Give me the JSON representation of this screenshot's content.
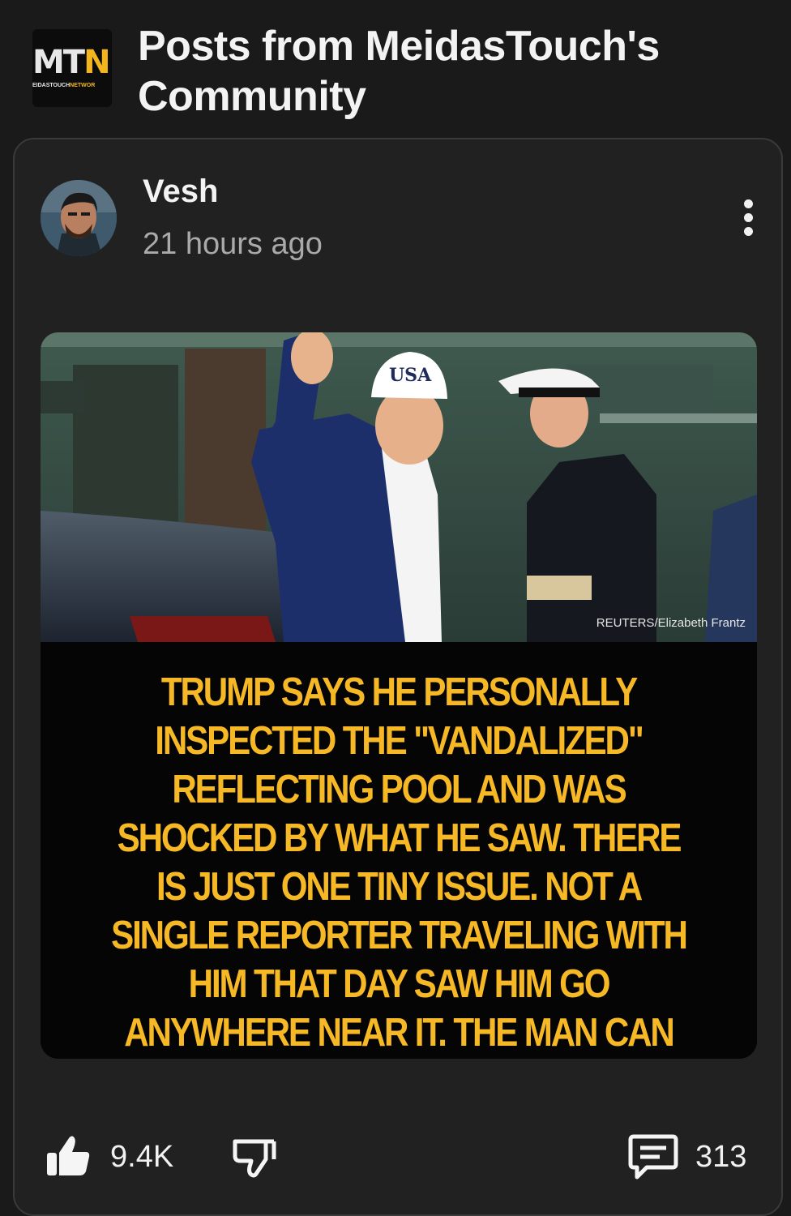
{
  "header": {
    "title": "Posts from MeidasTouch's Community",
    "logo": {
      "letters_main": "MT",
      "letters_accent": "N",
      "tagline_main": "EIDASTOUCH",
      "tagline_accent": "NETWOR"
    }
  },
  "post": {
    "author": "Vesh",
    "timestamp": "21 hours ago",
    "menu_icon": "more-vert-icon",
    "image": {
      "hat_text": "USA",
      "credit": "REUTERS/Elizabeth Frantz",
      "caption": "TRUMP SAYS HE PERSONALLY INSPECTED THE \"VANDALIZED\" REFLECTING POOL AND WAS SHOCKED BY WHAT HE SAW. THERE IS JUST ONE TINY ISSUE. NOT A SINGLE REPORTER TRAVELING WITH HIM THAT DAY SAW HIM GO ANYWHERE NEAR IT. THE MAN CAN NOT EVEN FAKE A SITE VISIT WITHOUT GETTING CAUGHT."
    },
    "actions": {
      "likes": "9.4K",
      "comments": "313",
      "like_icon": "thumbs-up-icon",
      "dislike_icon": "thumbs-down-icon",
      "comment_icon": "comment-icon"
    }
  },
  "colors": {
    "background": "#1a1a1a",
    "card": "#212121",
    "caption_text": "#f6b824",
    "brand_gold": "#f2b51e"
  }
}
